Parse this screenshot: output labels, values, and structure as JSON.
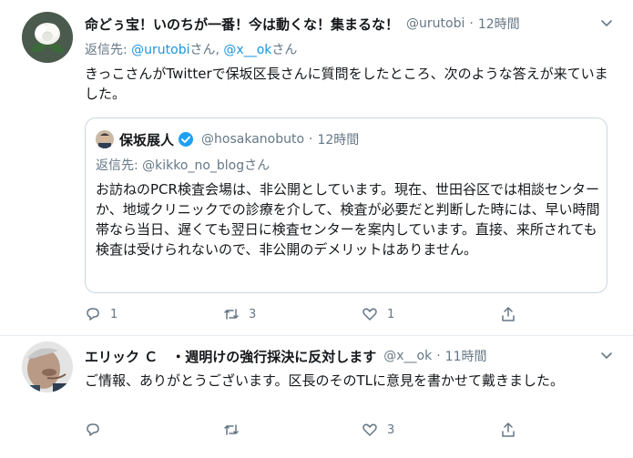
{
  "tweet1": {
    "name": "命どぅ宝！いのちが一番！今は動くな！集まるな！",
    "handle": "@urutobi",
    "dot": "·",
    "time": "12時間",
    "reply_prefix": "返信先: ",
    "reply_user1": "@urutobi",
    "reply_san1": "さん, ",
    "reply_user2": "@x__ok",
    "reply_san2": "さん",
    "text": "きっこさんがTwitterで保坂区長さんに質問をしたところ、次のような答えが来ていました。",
    "quote": {
      "name": "保坂展人",
      "handle": "@hosakanobuto",
      "dot": "·",
      "time": "12時間",
      "reply": "返信先: @kikko_no_blogさん",
      "text": "お訪ねのPCR検査会場は、非公開としています。現在、世田谷区では相談センターか、地域クリニックでの診療を介して、検査が必要だと判断した時には、早い時間帯なら当日、遅くても翌日に検査センターを案内しています。直接、来所されても検査は受けられないので、非公開のデメリットはありません。"
    },
    "actions": {
      "reply_count": "1",
      "retweet_count": "3",
      "like_count": "1"
    }
  },
  "tweet2": {
    "name": "エリック Ｃ　・週明けの強行採決に反対します",
    "handle": "@x__ok",
    "dot": "·",
    "time": "11時間",
    "text": "ご情報、ありがとうございます。区長のそのTLに意見を書かせて戴きました。",
    "actions": {
      "reply_count": "",
      "retweet_count": "",
      "like_count": "3"
    }
  },
  "icons": {
    "reply": "reply-icon",
    "retweet": "retweet-icon",
    "like": "heart-icon",
    "share": "share-icon",
    "more": "chevron-down-icon",
    "verified": "verified-badge-icon"
  },
  "colors": {
    "link": "#1b95e0",
    "secondary": "#657786",
    "text": "#14171a",
    "border": "#ccd6dd",
    "verified": "#1da1f2"
  }
}
